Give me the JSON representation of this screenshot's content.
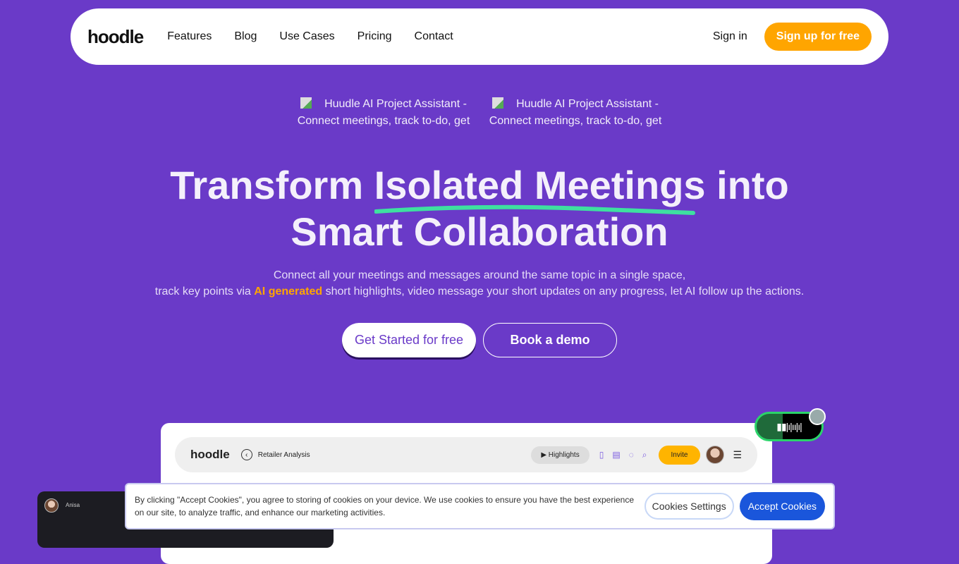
{
  "nav": {
    "logo": "hoodle",
    "links": [
      "Features",
      "Blog",
      "Use Cases",
      "Pricing",
      "Contact"
    ],
    "sign_in": "Sign in",
    "sign_up": "Sign up for free"
  },
  "hero_images": [
    {
      "alt": "Huudle AI Project Assistant - Connect meetings, track to-do, get"
    },
    {
      "alt": "Huudle AI Project Assistant - Connect meetings, track to-do, get"
    }
  ],
  "hero": {
    "title_pre": "Transform ",
    "title_highlight": "Isolated Meetings",
    "title_post": " into",
    "title_line2": "Smart Collaboration",
    "sub_line1": "Connect all your meetings and messages around the same topic in a single space,",
    "sub_pre": "track key points via ",
    "sub_accent": "AI generated",
    "sub_post": " short highlights, video message your short updates on any progress, let AI follow up the actions.",
    "cta_primary": "Get Started for free",
    "cta_secondary": "Book a demo"
  },
  "app_preview": {
    "logo": "hoodle",
    "title": "Retailer Analysis",
    "highlights": "Highlights",
    "invite": "Invite",
    "user": "Anisa"
  },
  "cookie": {
    "text": "By clicking \"Accept Cookies\", you agree to storing of cookies on your device. We use cookies to ensure you have the best experience on our site, to analyze traffic, and enhance our marketing activities.",
    "settings": "Cookies Settings",
    "accept": "Accept Cookies"
  },
  "colors": {
    "background": "#6a3ac8",
    "accent": "#ffa500",
    "highlight_underline": "#3ee0a0",
    "accept": "#1a56db"
  }
}
